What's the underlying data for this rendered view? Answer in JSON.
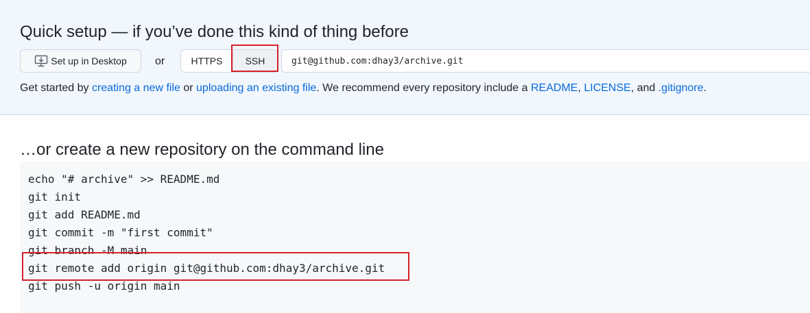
{
  "quick_setup": {
    "title": "Quick setup — if you’ve done this kind of thing before",
    "desktop_button_label": "Set up in Desktop",
    "or_label": "or",
    "protocols": {
      "https_label": "HTTPS",
      "ssh_label": "SSH",
      "selected": "SSH"
    },
    "clone_url": "git@github.com:dhay3/archive.git",
    "get_started": {
      "prefix": "Get started by ",
      "link_new_file": "creating a new file",
      "or_text": " or ",
      "link_upload": "uploading an existing file",
      "recommend_text": ". We recommend every repository include a ",
      "link_readme": "README",
      "comma": ",",
      "link_license": "LICENSE",
      "and_text": ", and ",
      "link_gitignore": ".gitignore",
      "period": "."
    }
  },
  "command_line": {
    "title": "…or create a new repository on the command line",
    "lines": [
      "echo \"# archive\" >> README.md",
      "git init",
      "git add README.md",
      "git commit -m \"first commit\"",
      "git branch -M main",
      "git remote add origin git@github.com:dhay3/archive.git",
      "git push -u origin main"
    ]
  },
  "colors": {
    "link": "#0969da",
    "highlight_box": "#d71f2c",
    "setup_background": "#f1f7fd",
    "code_background": "#f6f8fa"
  },
  "icons": {
    "desktop_button": "desktop-download-icon"
  }
}
